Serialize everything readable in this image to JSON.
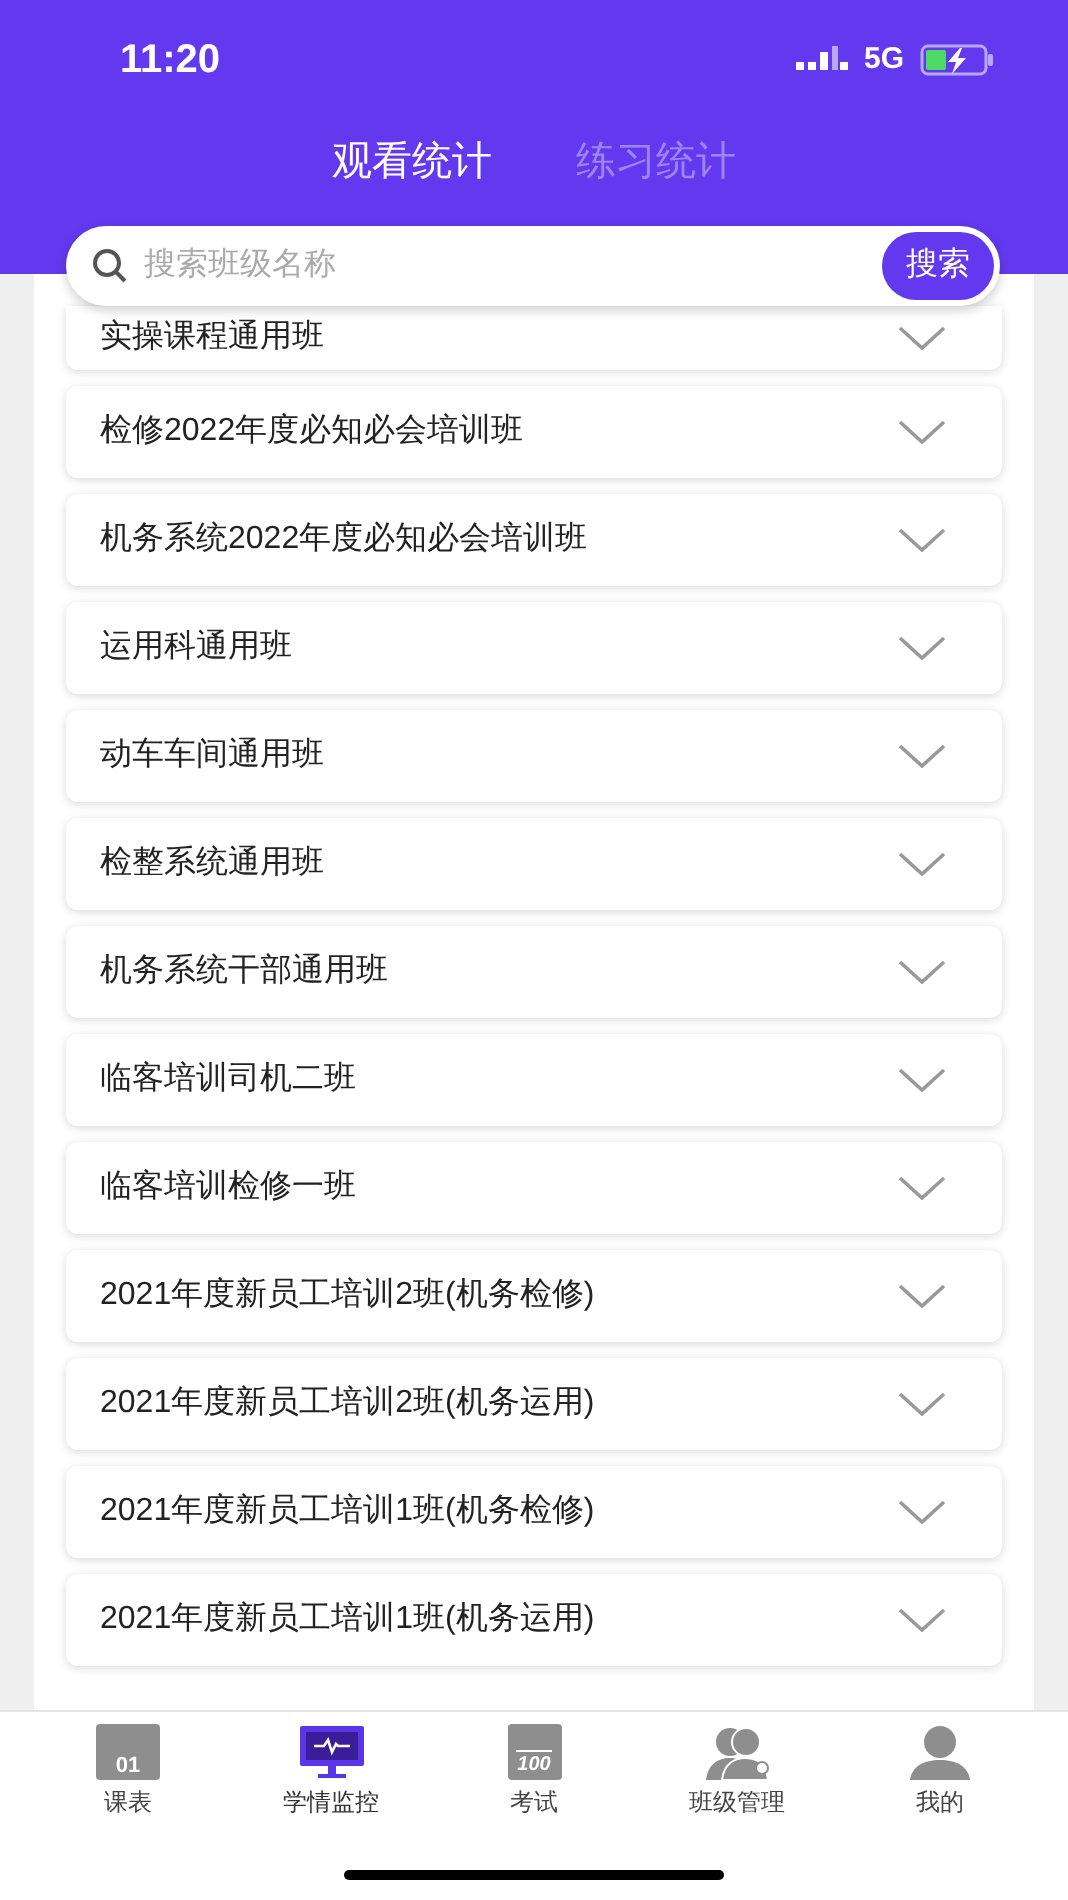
{
  "status_bar": {
    "time": "11:20",
    "network": "5G"
  },
  "tabs": [
    {
      "label": "观看统计",
      "selected": true
    },
    {
      "label": "练习统计",
      "selected": false
    }
  ],
  "search": {
    "placeholder": "搜索班级名称",
    "button": "搜索"
  },
  "classes": [
    {
      "name": "实操课程通用班",
      "expanded": false
    },
    {
      "name": "检修2022年度必知必会培训班",
      "expanded": false
    },
    {
      "name": "机务系统2022年度必知必会培训班",
      "expanded": false
    },
    {
      "name": "运用科通用班",
      "expanded": false
    },
    {
      "name": "动车车间通用班",
      "expanded": false
    },
    {
      "name": "检整系统通用班",
      "expanded": false
    },
    {
      "name": "机务系统干部通用班",
      "expanded": false
    },
    {
      "name": "临客培训司机二班",
      "expanded": false
    },
    {
      "name": "临客培训检修一班",
      "expanded": false
    },
    {
      "name": "2021年度新员工培训2班(机务检修)",
      "expanded": false
    },
    {
      "name": "2021年度新员工培训2班(机务运用)",
      "expanded": false
    },
    {
      "name": "2021年度新员工培训1班(机务检修)",
      "expanded": false
    },
    {
      "name": "2021年度新员工培训1班(机务运用)",
      "expanded": false
    }
  ],
  "bottom_nav": [
    {
      "kind": "calendar",
      "label": "课表",
      "icon_text": "01",
      "selected": false
    },
    {
      "kind": "monitor",
      "label": "学情监控",
      "selected": true
    },
    {
      "kind": "exam",
      "label": "考试",
      "icon_text": "100",
      "selected": false
    },
    {
      "kind": "group",
      "label": "班级管理",
      "selected": false
    },
    {
      "kind": "person",
      "label": "我的",
      "selected": false
    }
  ]
}
